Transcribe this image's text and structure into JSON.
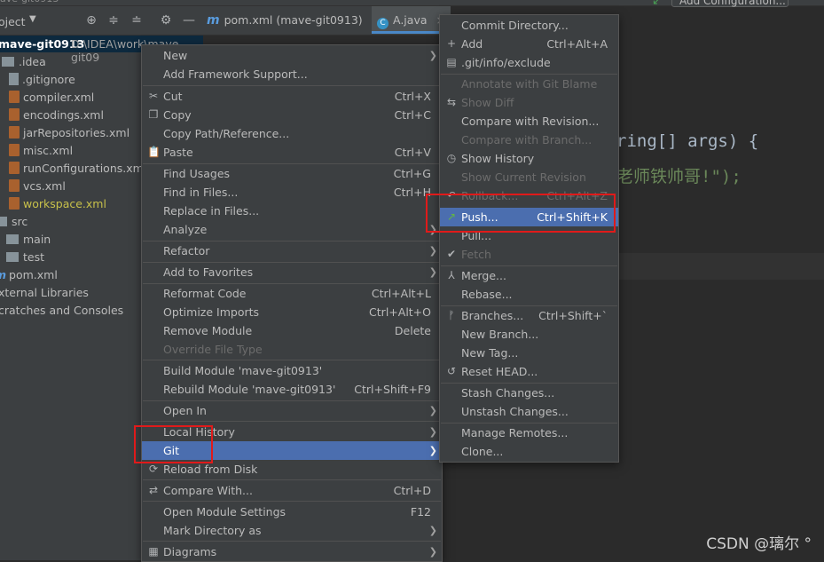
{
  "top": {
    "caption": "ave-git0913",
    "run_config_label": "Add Configuration..."
  },
  "project_toolbar": {
    "label": "oject",
    "icons": [
      "target-icon",
      "expand-all-icon",
      "collapse-all-icon",
      "gear-icon",
      "minimize-icon"
    ]
  },
  "editor_tabs": [
    {
      "label": "pom.xml (mave-git0913)",
      "icon": "maven-icon"
    },
    {
      "label": "A.java",
      "icon": "java-class-icon"
    }
  ],
  "tree": {
    "root_name": "mave-git0913",
    "root_path": "D:\\IDEA\\work\\mave-git09",
    "rows": [
      {
        "label": ".idea",
        "icon": "folder-icon"
      },
      {
        "label": ".gitignore",
        "icon": "file-icon"
      },
      {
        "label": "compiler.xml",
        "icon": "xml-icon"
      },
      {
        "label": "encodings.xml",
        "icon": "xml-icon"
      },
      {
        "label": "jarRepositories.xml",
        "icon": "xml-icon"
      },
      {
        "label": "misc.xml",
        "icon": "xml-icon"
      },
      {
        "label": "runConfigurations.xml",
        "icon": "xml-icon"
      },
      {
        "label": "vcs.xml",
        "icon": "xml-icon"
      },
      {
        "label": "workspace.xml",
        "icon": "xml-icon"
      },
      {
        "label": "src",
        "icon": "folder-icon"
      },
      {
        "label": "main",
        "icon": "folder-icon"
      },
      {
        "label": "test",
        "icon": "folder-icon"
      },
      {
        "label": "pom.xml",
        "icon": "maven-icon"
      },
      {
        "label": "xternal Libraries",
        "icon": "libraries-icon"
      },
      {
        "label": "cratches and Consoles",
        "icon": "scratches-icon"
      }
    ]
  },
  "editor": {
    "line1": "ring[] args) {",
    "line2": "老师铁帅哥!\");"
  },
  "context_menu": {
    "items": [
      {
        "label": "New",
        "shortcut": "",
        "submenu": true
      },
      {
        "label": "Add Framework Support...",
        "shortcut": ""
      },
      {
        "label": "Cut",
        "shortcut": "Ctrl+X",
        "icon": "scissors-icon"
      },
      {
        "label": "Copy",
        "shortcut": "Ctrl+C",
        "icon": "copy-icon"
      },
      {
        "label": "Copy Path/Reference...",
        "shortcut": ""
      },
      {
        "label": "Paste",
        "shortcut": "Ctrl+V",
        "icon": "paste-icon"
      },
      {
        "label": "Find Usages",
        "shortcut": "Ctrl+G"
      },
      {
        "label": "Find in Files...",
        "shortcut": "Ctrl+H"
      },
      {
        "label": "Replace in Files...",
        "shortcut": ""
      },
      {
        "label": "Analyze",
        "shortcut": "",
        "submenu": true
      },
      {
        "label": "Refactor",
        "shortcut": "",
        "submenu": true
      },
      {
        "label": "Add to Favorites",
        "shortcut": "",
        "submenu": true
      },
      {
        "label": "Reformat Code",
        "shortcut": "Ctrl+Alt+L"
      },
      {
        "label": "Optimize Imports",
        "shortcut": "Ctrl+Alt+O"
      },
      {
        "label": "Remove Module",
        "shortcut": "Delete"
      },
      {
        "label": "Override File Type",
        "shortcut": "",
        "disabled": true
      },
      {
        "label": "Build Module 'mave-git0913'",
        "shortcut": ""
      },
      {
        "label": "Rebuild Module 'mave-git0913'",
        "shortcut": "Ctrl+Shift+F9"
      },
      {
        "label": "Open In",
        "shortcut": "",
        "submenu": true
      },
      {
        "label": "Local History",
        "shortcut": "",
        "submenu": true
      },
      {
        "label": "Git",
        "shortcut": "",
        "submenu": true,
        "selected": true
      },
      {
        "label": "Reload from Disk",
        "shortcut": "",
        "icon": "reload-icon"
      },
      {
        "label": "Compare With...",
        "shortcut": "Ctrl+D",
        "icon": "compare-icon"
      },
      {
        "label": "Open Module Settings",
        "shortcut": "F12"
      },
      {
        "label": "Mark Directory as",
        "shortcut": "",
        "submenu": true
      },
      {
        "label": "Diagrams",
        "shortcut": "",
        "submenu": true,
        "icon": "diagram-icon"
      }
    ]
  },
  "git_menu": {
    "items": [
      {
        "label": "Commit Directory...",
        "shortcut": ""
      },
      {
        "label": "Add",
        "shortcut": "Ctrl+Alt+A",
        "icon": "plus-icon"
      },
      {
        "label": ".git/info/exclude",
        "shortcut": "",
        "icon": "git-file-icon"
      },
      {
        "label": "Annotate with Git Blame",
        "shortcut": "",
        "disabled": true
      },
      {
        "label": "Show Diff",
        "shortcut": "",
        "disabled": true,
        "icon": "diff-icon"
      },
      {
        "label": "Compare with Revision...",
        "shortcut": ""
      },
      {
        "label": "Compare with Branch...",
        "shortcut": "",
        "disabled": true
      },
      {
        "label": "Show History",
        "shortcut": "",
        "icon": "clock-icon"
      },
      {
        "label": "Show Current Revision",
        "shortcut": "",
        "disabled": true
      },
      {
        "label": "Rollback...",
        "shortcut": "Ctrl+Alt+Z",
        "disabled": true,
        "icon": "rollback-icon"
      },
      {
        "label": "Push...",
        "shortcut": "Ctrl+Shift+K",
        "selected": true,
        "icon": "push-arrow-icon"
      },
      {
        "label": "Pull...",
        "shortcut": ""
      },
      {
        "label": "Fetch",
        "shortcut": "",
        "disabled": true,
        "icon": "fetch-icon"
      },
      {
        "label": "Merge...",
        "shortcut": "",
        "icon": "merge-icon"
      },
      {
        "label": "Rebase...",
        "shortcut": ""
      },
      {
        "label": "Branches...",
        "shortcut": "Ctrl+Shift+`",
        "icon": "branch-icon"
      },
      {
        "label": "New Branch...",
        "shortcut": ""
      },
      {
        "label": "New Tag...",
        "shortcut": ""
      },
      {
        "label": "Reset HEAD...",
        "shortcut": "",
        "icon": "reset-icon"
      },
      {
        "label": "Stash Changes...",
        "shortcut": ""
      },
      {
        "label": "Unstash Changes...",
        "shortcut": ""
      },
      {
        "label": "Manage Remotes...",
        "shortcut": ""
      },
      {
        "label": "Clone...",
        "shortcut": ""
      }
    ]
  },
  "watermark": "CSDN @璃尔 °",
  "colors": {
    "menu_bg": "#3c3f41",
    "selection": "#4b6eaf",
    "annotation_red": "#e01a1a",
    "editor_bg": "#2b2b2b"
  }
}
